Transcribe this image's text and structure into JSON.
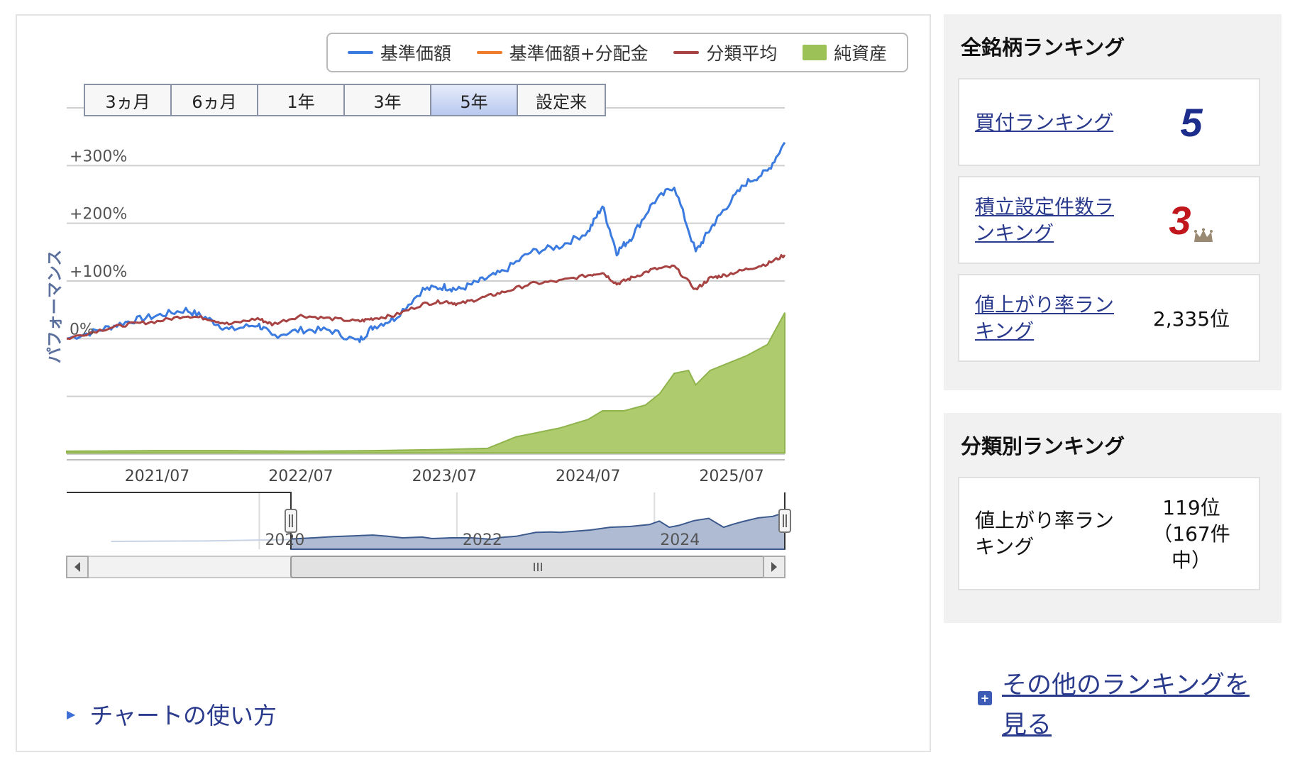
{
  "legend": {
    "items": [
      {
        "label": "基準価額",
        "color": "#3b7be0",
        "kind": "line"
      },
      {
        "label": "基準価額+分配金",
        "color": "#ee7c2a",
        "kind": "line"
      },
      {
        "label": "分類平均",
        "color": "#a84343",
        "kind": "line"
      },
      {
        "label": "純資産",
        "color": "#9cc257",
        "kind": "area"
      }
    ]
  },
  "range_buttons": [
    "3ヵ月",
    "6ヵ月",
    "1年",
    "3年",
    "5年",
    "設定来"
  ],
  "active_range": "5年",
  "chart_data": {
    "type": "line",
    "ylabel": "パフォーマンス",
    "y_ticks": [
      "+300%",
      "+200%",
      "+100%",
      "0%"
    ],
    "y_tick_values": [
      300,
      200,
      100,
      0
    ],
    "ylim": [
      -200,
      400
    ],
    "x_ticks": [
      "2021/07",
      "2022/07",
      "2023/07",
      "2024/07",
      "2025/07"
    ],
    "x_tick_positions": [
      2021.5,
      2022.5,
      2023.5,
      2024.5,
      2025.5
    ],
    "xlim": [
      2020.87,
      2025.87
    ],
    "grid": true,
    "legend_position": "top-right",
    "series": [
      {
        "name": "基準価額",
        "color": "#3b7be0",
        "x": [
          2020.87,
          2021.1,
          2021.3,
          2021.5,
          2021.7,
          2021.85,
          2022.0,
          2022.2,
          2022.3,
          2022.5,
          2022.7,
          2022.9,
          2023.0,
          2023.15,
          2023.35,
          2023.5,
          2023.6,
          2023.75,
          2023.9,
          2024.1,
          2024.3,
          2024.5,
          2024.6,
          2024.7,
          2024.8,
          2024.95,
          2025.1,
          2025.25,
          2025.35,
          2025.45,
          2025.6,
          2025.75,
          2025.87
        ],
        "y": [
          0,
          15,
          30,
          40,
          50,
          35,
          15,
          25,
          5,
          15,
          15,
          -5,
          20,
          35,
          85,
          90,
          85,
          100,
          115,
          150,
          160,
          185,
          230,
          150,
          175,
          235,
          265,
          150,
          190,
          225,
          270,
          290,
          340
        ]
      },
      {
        "name": "分類平均",
        "color": "#a84343",
        "x": [
          2020.87,
          2021.1,
          2021.3,
          2021.5,
          2021.7,
          2021.85,
          2022.0,
          2022.2,
          2022.3,
          2022.5,
          2022.7,
          2022.9,
          2023.0,
          2023.15,
          2023.35,
          2023.5,
          2023.6,
          2023.75,
          2023.9,
          2024.1,
          2024.3,
          2024.5,
          2024.6,
          2024.7,
          2024.8,
          2024.95,
          2025.1,
          2025.25,
          2025.35,
          2025.45,
          2025.6,
          2025.75,
          2025.87
        ],
        "y": [
          0,
          15,
          25,
          30,
          40,
          35,
          25,
          35,
          25,
          40,
          35,
          30,
          35,
          40,
          60,
          65,
          60,
          70,
          80,
          95,
          100,
          110,
          115,
          95,
          105,
          120,
          125,
          85,
          105,
          110,
          120,
          130,
          145
        ]
      },
      {
        "name": "純資産",
        "color": "#9cc257",
        "kind": "area",
        "x": [
          2020.87,
          2021.5,
          2022.0,
          2022.5,
          2023.0,
          2023.5,
          2023.8,
          2024.0,
          2024.3,
          2024.5,
          2024.6,
          2024.75,
          2024.9,
          2025.0,
          2025.1,
          2025.2,
          2025.25,
          2025.35,
          2025.45,
          2025.6,
          2025.75,
          2025.87
        ],
        "y": [
          -195,
          -194,
          -194,
          -195,
          -194,
          -192,
          -190,
          -170,
          -155,
          -140,
          -125,
          -125,
          -115,
          -95,
          -60,
          -55,
          -80,
          -55,
          -45,
          -30,
          -10,
          45
        ]
      }
    ],
    "navigator": {
      "labels": [
        "2020",
        "2022",
        "2024"
      ]
    }
  },
  "howto_label": "チャートの使い方",
  "all_ranking": {
    "title": "全銘柄ランキング",
    "items": [
      {
        "label": "買付ランキング",
        "value": "5"
      },
      {
        "label": "積立設定件数ランキング",
        "value": "3"
      },
      {
        "label": "値上がり率ランキング",
        "value": "2,335位"
      }
    ]
  },
  "category_ranking": {
    "title": "分類別ランキング",
    "items": [
      {
        "label": "値上がり率ランキング",
        "value": "119位（167件中）"
      }
    ]
  },
  "more_link": "その他のランキングを見る"
}
